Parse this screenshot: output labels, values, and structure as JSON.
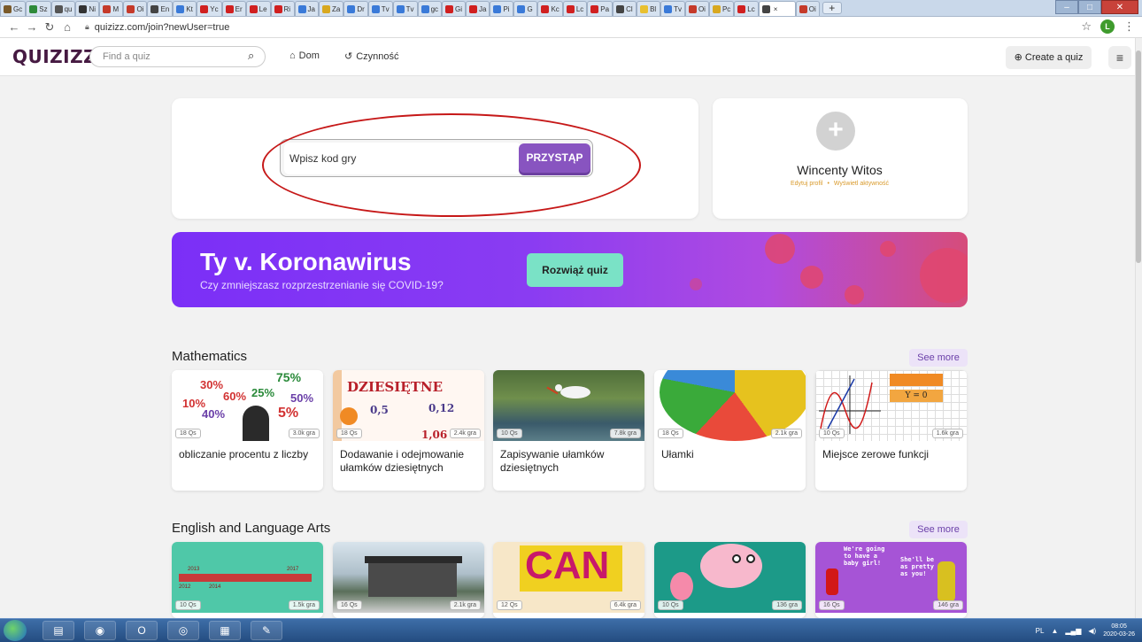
{
  "browser": {
    "tabs": [
      "Gc",
      "Sz",
      "qu",
      "Ni",
      "M",
      "Oi",
      "En",
      "Kt",
      "Yc",
      "Er",
      "Le",
      "Ri",
      "Ja",
      "Za",
      "Dr",
      "Tv",
      "Tv",
      "gc",
      "Gi",
      "Ja",
      "Pi",
      "G",
      "Kc",
      "Lc",
      "Pa",
      "Cl",
      "Bl",
      "Tv",
      "Oi",
      "Pc",
      "Lc",
      "",
      "Oi"
    ],
    "new_tab": "+",
    "url": "quizizz.com/join?newUser=true",
    "profile_initial": "L"
  },
  "header": {
    "logo": "QUIZIZZ",
    "search_placeholder": "Find a quiz",
    "nav": [
      "Dom",
      "Czynność"
    ],
    "create_label": "Create a quiz"
  },
  "join": {
    "input_placeholder": "Wpisz kod gry",
    "button_label": "PRZYSTĄP"
  },
  "profile": {
    "name": "Wincenty Witos",
    "edit_link": "Edytuj profil",
    "separator": "•",
    "activity_link": "Wyświetl aktywność"
  },
  "banner": {
    "title": "Ty v. Koronawirus",
    "subtitle": "Czy zmniejszasz rozprzestrzenianie się COVID-19?",
    "button_label": "Rozwiąż quiz"
  },
  "sections": [
    {
      "title": "Mathematics",
      "see_more": "See more",
      "quizzes": [
        {
          "name": "obliczanie procentu z liczby",
          "questions": "18 Qs",
          "plays": "3.0k gra"
        },
        {
          "name": "Dodawanie i odejmowanie ułamków dziesiętnych",
          "questions": "18 Qs",
          "plays": "2.4k gra"
        },
        {
          "name": "Zapisywanie ułamków dziesiętnych",
          "questions": "10 Qs",
          "plays": "7.8k gra"
        },
        {
          "name": "Ułamki",
          "questions": "18 Qs",
          "plays": "2.1k gra"
        },
        {
          "name": "Miejsce zerowe funkcji",
          "questions": "10 Qs",
          "plays": "1.6k gra"
        }
      ]
    },
    {
      "title": "English and Language Arts",
      "see_more": "See more",
      "quizzes": [
        {
          "questions": "10 Qs",
          "plays": "1.5k gra"
        },
        {
          "questions": "16 Qs",
          "plays": "2.1k gra"
        },
        {
          "questions": "12 Qs",
          "plays": "6.4k gra"
        },
        {
          "questions": "10 Qs",
          "plays": "136 gra"
        },
        {
          "questions": "16 Qs",
          "plays": "146 gra"
        }
      ]
    }
  ],
  "thumb_text": {
    "percent": [
      "75%",
      "30%",
      "60%",
      "25%",
      "50%",
      "10%",
      "40%",
      "5%"
    ],
    "decimals_title": "DZIESIĘTNE",
    "decimals_values": [
      "0,5",
      "0,12",
      "1,06"
    ],
    "equation": "Y = 0",
    "years": [
      "2013",
      "2012",
      "2014",
      "2017"
    ],
    "can": "CAN",
    "baby_left": "We're going to have a baby girl!",
    "baby_right": "She'll be as pretty as you!"
  },
  "taskbar": {
    "lang": "PL",
    "time": "08:05",
    "date": "2020-03-26"
  },
  "colors": {
    "brand": "#461a42",
    "join_button": "#8854c0",
    "banner_button": "#7ae2c6",
    "annotation": "#c61818"
  }
}
